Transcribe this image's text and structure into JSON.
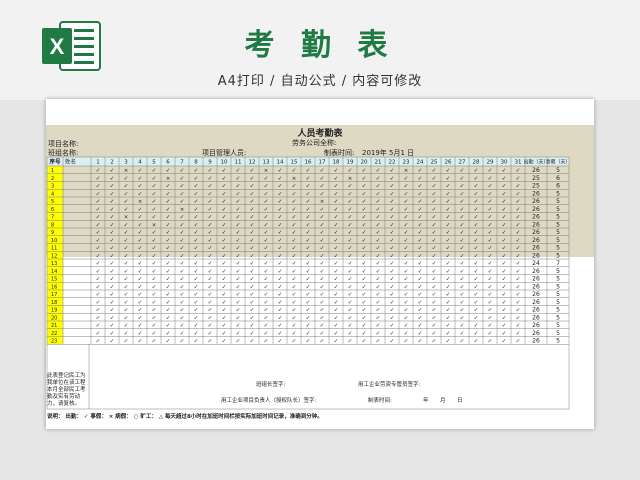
{
  "header": {
    "title": "考 勤 表",
    "subtitle": "A4打印 / 自动公式 / 内容可修改"
  },
  "sheet": {
    "title": "人员考勤表",
    "labor_company": "劳务公司全称:",
    "project_name": "项目名称:",
    "team_name": "班组名称:",
    "manager": "项目管理人员:",
    "made_date_label": "制表时间:",
    "made_date_value": "2019年  5月1  日",
    "col_index": "序号",
    "col_name": "姓名",
    "col_attend": "出勤（天）",
    "col_leave": "事假（天）",
    "days": [
      "1",
      "2",
      "3",
      "4",
      "5",
      "6",
      "7",
      "8",
      "9",
      "10",
      "11",
      "12",
      "13",
      "14",
      "15",
      "16",
      "17",
      "18",
      "19",
      "20",
      "21",
      "22",
      "23",
      "24",
      "25",
      "26",
      "27",
      "28",
      "29",
      "30",
      "31"
    ],
    "rows": [
      {
        "idx": "1",
        "marks": "✓✓×✓✓✓✓✓✓✓✓✓×✓✓✓✓✓✓✓✓✓×✓✓✓✓✓✓✓✓",
        "attend": "26",
        "leave": "5"
      },
      {
        "idx": "2",
        "marks": "✓✓✓✓✓×✓✓✓✓✓✓✓✓×✓✓✓×✓✓✓✓✓✓✓✓✓✓✓✓",
        "attend": "25",
        "leave": "6"
      },
      {
        "idx": "3",
        "marks": "✓✓✓✓✓✓✓✓✓✓✓✓✓✓✓✓✓✓✓✓✓✓✓✓✓✓✓✓✓✓✓",
        "attend": "25",
        "leave": "6"
      },
      {
        "idx": "4",
        "marks": "✓✓✓✓✓✓✓✓✓✓✓✓✓✓✓✓✓✓✓✓✓✓✓✓✓✓✓✓✓✓✓",
        "attend": "26",
        "leave": "5"
      },
      {
        "idx": "5",
        "marks": "✓✓✓×✓✓✓✓✓✓✓✓✓✓✓✓×✓✓✓✓✓✓✓✓✓✓✓✓✓✓",
        "attend": "26",
        "leave": "5"
      },
      {
        "idx": "6",
        "marks": "✓✓✓✓✓✓×✓✓✓✓✓✓✓✓✓✓✓✓✓✓✓✓✓✓✓✓✓✓✓✓",
        "attend": "26",
        "leave": "5"
      },
      {
        "idx": "7",
        "marks": "✓✓×✓✓✓✓✓✓✓✓✓✓✓✓✓✓✓✓✓✓✓✓✓✓✓✓✓✓✓✓",
        "attend": "26",
        "leave": "5"
      },
      {
        "idx": "8",
        "marks": "✓✓✓✓×✓✓✓✓✓✓✓✓✓✓✓✓✓✓✓✓✓✓✓✓✓✓✓✓✓✓",
        "attend": "26",
        "leave": "5"
      },
      {
        "idx": "9",
        "marks": "✓✓✓✓✓✓✓✓✓✓✓✓✓✓✓✓✓✓✓✓✓✓✓✓✓✓✓✓✓✓✓",
        "attend": "26",
        "leave": "5"
      },
      {
        "idx": "10",
        "marks": "✓✓✓✓✓✓✓✓✓✓✓✓✓✓✓✓✓✓✓✓✓✓✓✓✓✓✓✓✓✓✓",
        "attend": "26",
        "leave": "5"
      },
      {
        "idx": "11",
        "marks": "✓✓✓✓✓✓✓✓✓✓✓✓✓✓✓✓✓✓✓✓✓✓✓✓✓✓✓✓✓✓✓",
        "attend": "26",
        "leave": "5"
      },
      {
        "idx": "12",
        "marks": "✓✓✓✓✓✓✓✓✓✓✓✓✓✓✓✓✓✓✓✓✓✓✓✓✓✓✓✓✓✓✓",
        "attend": "26",
        "leave": "5"
      },
      {
        "idx": "13",
        "marks": "✓✓✓✓✓✓✓✓✓✓✓✓✓✓✓✓✓✓✓✓✓✓✓✓✓✓✓✓✓✓✓",
        "attend": "24",
        "leave": "7"
      },
      {
        "idx": "14",
        "marks": "✓✓✓✓✓✓✓✓✓✓✓✓✓✓✓✓✓✓✓✓✓✓✓✓✓✓✓✓✓✓✓",
        "attend": "26",
        "leave": "5"
      },
      {
        "idx": "15",
        "marks": "✓✓✓✓✓✓✓✓✓✓✓✓✓✓✓✓✓✓✓✓✓✓✓✓✓✓✓✓✓✓✓",
        "attend": "26",
        "leave": "5"
      },
      {
        "idx": "16",
        "marks": "✓✓✓✓✓✓✓✓✓✓✓✓✓✓✓✓✓✓✓✓✓✓✓✓✓✓✓✓✓✓✓",
        "attend": "26",
        "leave": "5"
      },
      {
        "idx": "17",
        "marks": "✓✓✓✓✓✓✓✓✓✓✓✓✓✓✓✓✓✓✓✓✓✓✓✓✓✓✓✓✓✓✓",
        "attend": "26",
        "leave": "5"
      },
      {
        "idx": "18",
        "marks": "✓✓✓✓✓✓✓✓✓✓✓✓✓✓✓✓✓✓✓✓✓✓✓✓✓✓✓✓✓✓✓",
        "attend": "26",
        "leave": "5"
      },
      {
        "idx": "19",
        "marks": "✓✓✓✓✓✓✓✓✓✓✓✓✓✓✓✓✓✓✓✓✓✓✓✓✓✓✓✓✓✓✓",
        "attend": "26",
        "leave": "5"
      },
      {
        "idx": "20",
        "marks": "✓✓✓✓✓✓✓✓✓✓✓✓✓✓✓✓✓✓✓✓✓✓✓✓✓✓✓✓✓✓✓",
        "attend": "26",
        "leave": "5"
      },
      {
        "idx": "21",
        "marks": "✓✓✓✓✓✓✓✓✓✓✓✓✓✓✓✓✓✓✓✓✓✓✓✓✓✓✓✓✓✓✓",
        "attend": "26",
        "leave": "5"
      },
      {
        "idx": "22",
        "marks": "✓✓✓✓✓✓✓✓✓✓✓✓✓✓✓✓✓✓✓✓✓✓✓✓✓✓✓✓✓✓✓",
        "attend": "26",
        "leave": "5"
      },
      {
        "idx": "23",
        "marks": "✓✓✓✓✓✓✓✓✓✓✓✓✓✓✓✓✓✓✓✓✓✓✓✓✓✓✓✓✓✓✓",
        "attend": "26",
        "leave": "5"
      }
    ],
    "note": "此表登记民工为我单位在该工程本月全部民工考勤及实有劳动力，请复核。",
    "team_leader_sign": "班组长签字:",
    "company_labor_sign": "用工企业劳资专管员签字:",
    "project_leader_sign": "用工企业项目负责人（授权队长）签字:",
    "sign_date": "制表时间:",
    "year": "年",
    "month": "月",
    "day": "日",
    "legend": "说明：  出勤： ✓    事假： ×    病假： ○    旷工： △    每天超过8小时在加班时间栏按实际加班时间记录，准确到分钟。"
  },
  "colors": {
    "brand_green": "#1f7a43",
    "band": "#ddd9c3",
    "header_cyan": "#dbeef3",
    "index_yellow": "#ffff00",
    "grid": "#7f7f7f"
  }
}
